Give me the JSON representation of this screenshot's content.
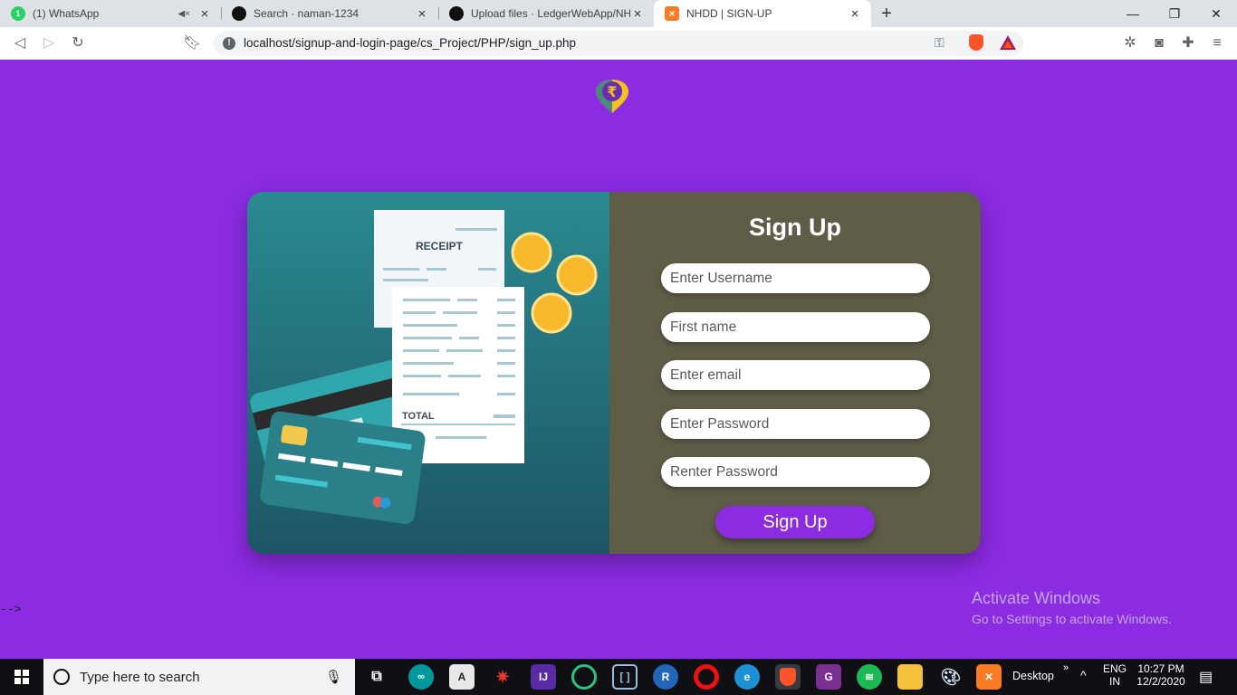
{
  "browser": {
    "tabs": [
      {
        "title": "(1) WhatsApp",
        "favicon": "whatsapp-icon",
        "badge": "1",
        "muted": true
      },
      {
        "title": "Search · naman-1234",
        "favicon": "github-icon"
      },
      {
        "title": "Upload files · LedgerWebApp/NHD",
        "favicon": "github-icon"
      },
      {
        "title": "NHDD | SIGN-UP",
        "favicon": "xampp-icon",
        "active": true
      }
    ],
    "new_tab": "+",
    "window_controls": {
      "minimize": "—",
      "restore": "❐",
      "close": "✕"
    },
    "url": "localhost/signup-and-login-page/cs_Project/PHP/sign_up.php"
  },
  "page": {
    "form": {
      "title": "Sign Up",
      "fields": [
        {
          "placeholder": "Enter Username"
        },
        {
          "placeholder": "First name"
        },
        {
          "placeholder": "Enter email"
        },
        {
          "placeholder": "Enter Password"
        },
        {
          "placeholder": "Renter Password"
        }
      ],
      "submit_label": "Sign Up"
    },
    "illustration": {
      "receipt_title": "RECEIPT",
      "total_label": "TOTAL",
      "logo_symbol": "₹"
    },
    "stray_text": "-->",
    "watermark": {
      "line1": "Activate Windows",
      "line2": "Go to Settings to activate Windows."
    }
  },
  "taskbar": {
    "search_placeholder": "Type here to search",
    "desktop_label": "Desktop",
    "language": "ENG",
    "region": "IN",
    "time": "10:27 PM",
    "date": "12/2/2020"
  },
  "colors": {
    "page_bg": "#8b2be2",
    "form_panel": "#5f5c48",
    "button": "#8b2be2",
    "illustration_top": "#2a8a91",
    "illustration_bottom": "#1d5566"
  }
}
